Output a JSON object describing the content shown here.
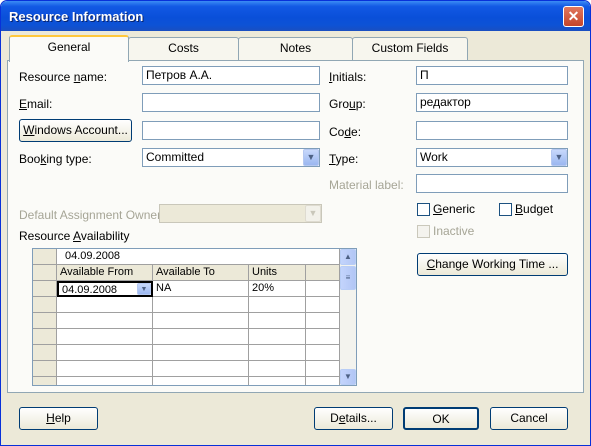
{
  "window": {
    "title": "Resource Information",
    "close_glyph": "✕"
  },
  "tabs": [
    {
      "label": "General",
      "active": true
    },
    {
      "label": "Costs",
      "active": false
    },
    {
      "label": "Notes",
      "active": false
    },
    {
      "label": "Custom Fields",
      "active": false
    }
  ],
  "form": {
    "resource_name": {
      "label_pre": "Resource ",
      "label_ul": "n",
      "label_post": "ame:",
      "value": "Петров А.А."
    },
    "email": {
      "label_pre": "",
      "label_ul": "E",
      "label_post": "mail:",
      "value": ""
    },
    "windows_account": {
      "label_pre": "",
      "label_ul": "W",
      "label_post": "indows Account...",
      "value": ""
    },
    "booking_type": {
      "label_pre": "Boo",
      "label_ul": "k",
      "label_post": "ing type:",
      "value": "Committed"
    },
    "initials": {
      "label_pre": "",
      "label_ul": "I",
      "label_post": "nitials:",
      "value": "П"
    },
    "group": {
      "label_pre": "Gro",
      "label_ul": "u",
      "label_post": "p:",
      "value": "редактор"
    },
    "code": {
      "label_pre": "Co",
      "label_ul": "d",
      "label_post": "e:",
      "value": ""
    },
    "type": {
      "label_pre": "",
      "label_ul": "T",
      "label_post": "ype:",
      "value": "Work"
    },
    "material_label": {
      "label": "Material label:",
      "value": ""
    },
    "default_owner": {
      "label": "Default Assignment Owner:",
      "value": ""
    },
    "generic": {
      "label_pre": "",
      "label_ul": "G",
      "label_post": "eneric",
      "checked": false
    },
    "budget": {
      "label_pre": "",
      "label_ul": "B",
      "label_post": "udget",
      "checked": false
    },
    "inactive": {
      "label": "Inactive",
      "checked": false
    },
    "change_working_time": {
      "label_pre": "",
      "label_ul": "C",
      "label_post": "hange Working Time ..."
    }
  },
  "availability": {
    "label_pre": "Resource ",
    "label_ul": "A",
    "label_post": "vailability",
    "edit_value": "04.09.2008",
    "columns": [
      "Available From",
      "Available To",
      "Units"
    ],
    "rows": [
      {
        "from": "04.09.2008",
        "to": "NA",
        "units": "20%"
      }
    ]
  },
  "footer": {
    "help": {
      "label_pre": "",
      "label_ul": "H",
      "label_post": "elp"
    },
    "details": {
      "label_pre": "D",
      "label_ul": "e",
      "label_post": "tails..."
    },
    "ok": "OK",
    "cancel": "Cancel"
  },
  "icons": {
    "dropdown": "chevron-down-icon",
    "scroll_up": "arrow-up-icon",
    "scroll_down": "arrow-down-icon"
  }
}
